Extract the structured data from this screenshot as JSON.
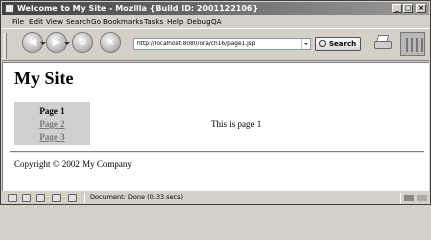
{
  "window": {
    "title": "Welcome to My Site - Mozilla {Build ID: 2001122106}",
    "controls": {
      "minimize": "_",
      "maximize": "□",
      "close": "×"
    }
  },
  "menubar": {
    "items": [
      "File",
      "Edit",
      "View",
      "Search",
      "Go",
      "Bookmarks",
      "Tasks",
      "Help",
      "Debug",
      "QA"
    ]
  },
  "toolbar": {
    "back_icon": "back-arrow-icon",
    "forward_icon": "forward-arrow-icon",
    "reload_icon": "reload-icon",
    "stop_icon": "stop-icon",
    "url": "http://localhost:8080/ora/ch16/page1.jsp",
    "search_label": "Search",
    "print_icon": "print-icon",
    "throbber_icon": "mozilla-throbber-icon"
  },
  "page": {
    "site_title": "My Site",
    "nav": [
      {
        "label": "Page 1",
        "active": true
      },
      {
        "label": "Page 2",
        "active": false
      },
      {
        "label": "Page 3",
        "active": false
      }
    ],
    "main_text": "This is page 1",
    "footer": "Copyright © 2002 My Company"
  },
  "statusbar": {
    "text": "Document: Done (0.33 secs)"
  },
  "colors": {
    "chrome": "#d4d0c8",
    "content_bg": "#ffffff",
    "nav_bg": "#d0d0d0",
    "link_gray": "#7a7a7a"
  }
}
